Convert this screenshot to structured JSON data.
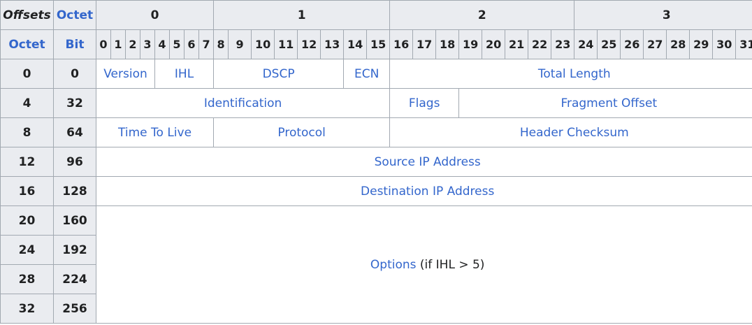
{
  "header": {
    "offsets": "Offsets",
    "octet": "Octet",
    "octet_col": "Octet",
    "bit_col": "Bit",
    "octet_groups": [
      "0",
      "1",
      "2",
      "3"
    ],
    "bits": [
      "0",
      "1",
      "2",
      "3",
      "4",
      "5",
      "6",
      "7",
      "8",
      "9",
      "10",
      "11",
      "12",
      "13",
      "14",
      "15",
      "16",
      "17",
      "18",
      "19",
      "20",
      "21",
      "22",
      "23",
      "24",
      "25",
      "26",
      "27",
      "28",
      "29",
      "30",
      "31"
    ]
  },
  "rows": [
    {
      "octet": "0",
      "bit": "0"
    },
    {
      "octet": "4",
      "bit": "32"
    },
    {
      "octet": "8",
      "bit": "64"
    },
    {
      "octet": "12",
      "bit": "96"
    },
    {
      "octet": "16",
      "bit": "128"
    },
    {
      "octet": "20",
      "bit": "160"
    },
    {
      "octet": "24",
      "bit": "192"
    },
    {
      "octet": "28",
      "bit": "224"
    },
    {
      "octet": "32",
      "bit": "256"
    }
  ],
  "fields": {
    "version": "Version",
    "ihl": "IHL",
    "dscp": "DSCP",
    "ecn": "ECN",
    "total_length": "Total Length",
    "identification": "Identification",
    "flags": "Flags",
    "fragment_offset": "Fragment Offset",
    "ttl": "Time To Live",
    "protocol": "Protocol",
    "header_checksum": "Header Checksum",
    "source_ip": "Source IP Address",
    "destination_ip": "Destination IP Address",
    "options": "Options",
    "options_note": "(if IHL > 5)"
  }
}
